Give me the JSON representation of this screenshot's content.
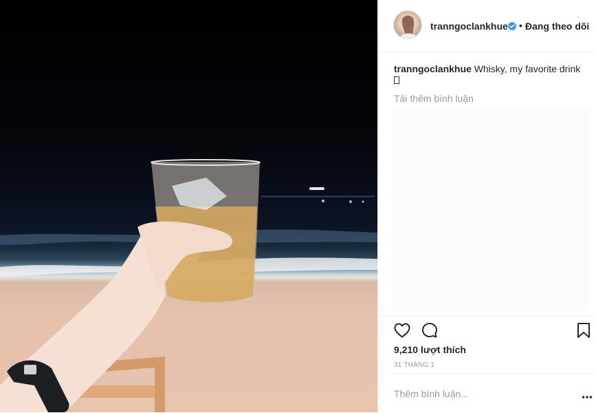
{
  "post": {
    "username": "tranngoclankhue",
    "follow_status": "Đang theo dõi",
    "separator": "•",
    "caption_username": "tranngoclankhue",
    "caption_text": "Whisky, my favorite drink",
    "load_more_comments": "Tải thêm bình luận",
    "likes_count": "9,210",
    "likes_label": "lượt thích",
    "date": "31 THÁNG 1",
    "comment_placeholder": "Thêm bình luận..."
  },
  "icons": {
    "verified": "verified-badge-icon",
    "like": "heart-icon",
    "comment": "comment-bubble-icon",
    "save": "bookmark-icon",
    "more": "more-options-icon"
  },
  "colors": {
    "text": "#262626",
    "muted": "#999999",
    "verified": "#3897f0",
    "border": "#efefef"
  }
}
